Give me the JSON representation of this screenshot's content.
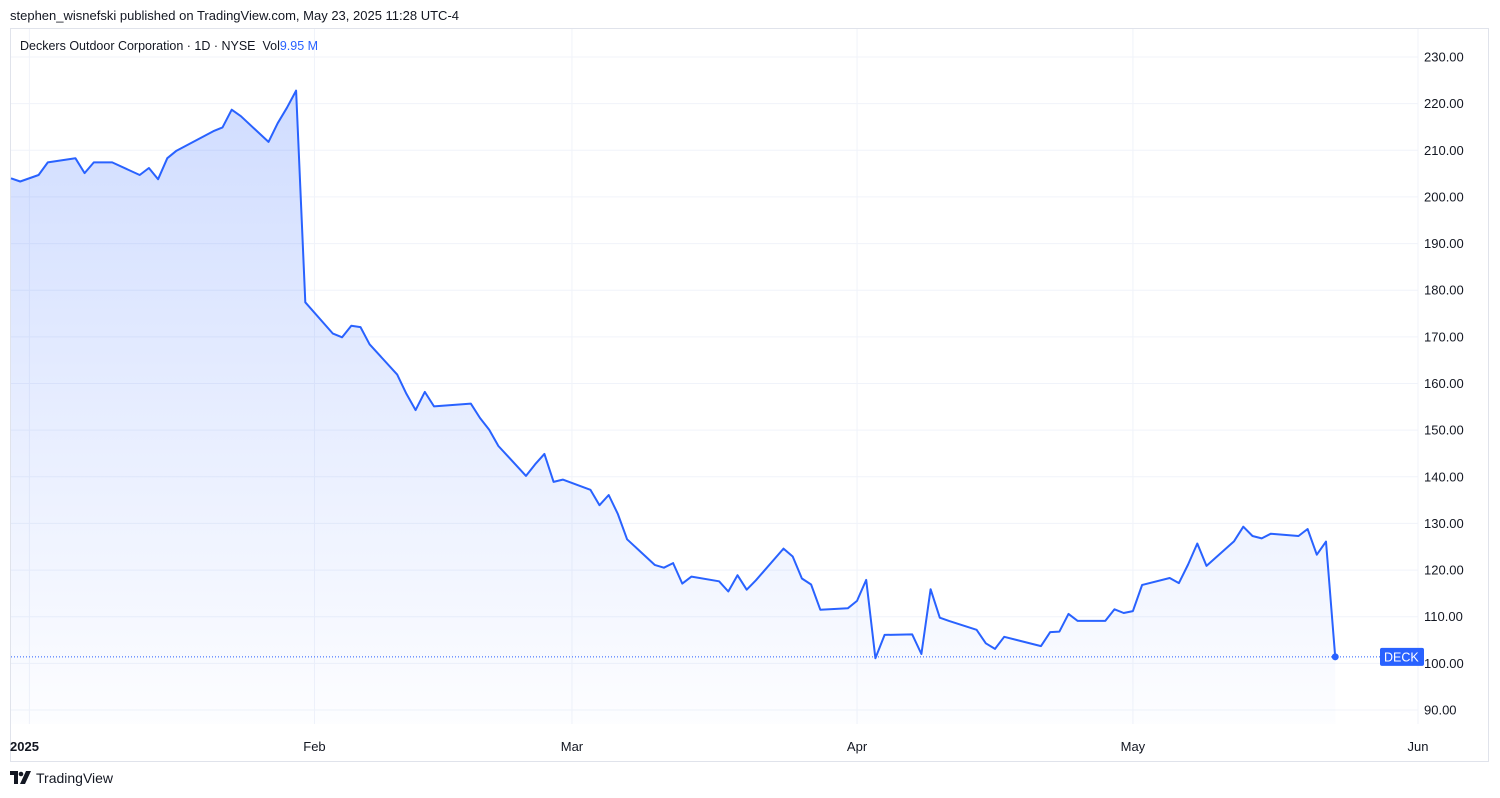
{
  "publisher_line": "stephen_wisnefski published on TradingView.com, May 23, 2025 11:28 UTC-4",
  "legend": {
    "symbol": "Deckers Outdoor Corporation · 1D · NYSE",
    "vol_label": "Vol",
    "vol_value": "9.95 M"
  },
  "footer": {
    "brand": "TradingView",
    "logo_icon": "tradingview-logo-icon"
  },
  "colors": {
    "line": "#2962ff",
    "grid": "#f0f3fa",
    "axis_text": "#131722"
  },
  "chart_data": {
    "type": "area",
    "title": "",
    "ylim": [
      87,
      236
    ],
    "y_ticks": [
      90,
      100,
      110,
      120,
      130,
      140,
      150,
      160,
      170,
      180,
      190,
      200,
      210,
      220,
      230
    ],
    "y_tick_labels": [
      "90.00",
      "100.00",
      "110.00",
      "120.00",
      "130.00",
      "140.00",
      "150.00",
      "160.00",
      "170.00",
      "180.00",
      "190.00",
      "200.00",
      "210.00",
      "220.00",
      "230.00"
    ],
    "x_ticks": [
      {
        "date": "2025-01-01",
        "label": "2025",
        "bold": true
      },
      {
        "date": "2025-02-01",
        "label": "Feb"
      },
      {
        "date": "2025-03-01",
        "label": "Mar"
      },
      {
        "date": "2025-04-01",
        "label": "Apr"
      },
      {
        "date": "2025-05-01",
        "label": "May"
      },
      {
        "date": "2025-06-01",
        "label": "Jun"
      }
    ],
    "xlim": [
      "2024-12-30",
      "2025-06-01"
    ],
    "last_value_label": "DECK",
    "last_value": 101.4,
    "grid": true,
    "series": [
      {
        "x": [
          "2024-12-30",
          "2024-12-31",
          "2025-01-02",
          "2025-01-03",
          "2025-01-06",
          "2025-01-07",
          "2025-01-08",
          "2025-01-10",
          "2025-01-13",
          "2025-01-14",
          "2025-01-15",
          "2025-01-16",
          "2025-01-17",
          "2025-01-21",
          "2025-01-22",
          "2025-01-23",
          "2025-01-24",
          "2025-01-27",
          "2025-01-28",
          "2025-01-29",
          "2025-01-30",
          "2025-01-31",
          "2025-02-03",
          "2025-02-04",
          "2025-02-05",
          "2025-02-06",
          "2025-02-07",
          "2025-02-10",
          "2025-02-11",
          "2025-02-12",
          "2025-02-13",
          "2025-02-14",
          "2025-02-18",
          "2025-02-19",
          "2025-02-20",
          "2025-02-21",
          "2025-02-24",
          "2025-02-25",
          "2025-02-26",
          "2025-02-27",
          "2025-02-28",
          "2025-03-03",
          "2025-03-04",
          "2025-03-05",
          "2025-03-06",
          "2025-03-07",
          "2025-03-10",
          "2025-03-11",
          "2025-03-12",
          "2025-03-13",
          "2025-03-14",
          "2025-03-17",
          "2025-03-18",
          "2025-03-19",
          "2025-03-20",
          "2025-03-21",
          "2025-03-24",
          "2025-03-25",
          "2025-03-26",
          "2025-03-27",
          "2025-03-28",
          "2025-03-31",
          "2025-04-01",
          "2025-04-02",
          "2025-04-03",
          "2025-04-04",
          "2025-04-07",
          "2025-04-08",
          "2025-04-09",
          "2025-04-10",
          "2025-04-11",
          "2025-04-14",
          "2025-04-15",
          "2025-04-16",
          "2025-04-17",
          "2025-04-21",
          "2025-04-22",
          "2025-04-23",
          "2025-04-24",
          "2025-04-25",
          "2025-04-28",
          "2025-04-29",
          "2025-04-30",
          "2025-05-01",
          "2025-05-02",
          "2025-05-05",
          "2025-05-06",
          "2025-05-07",
          "2025-05-08",
          "2025-05-09",
          "2025-05-12",
          "2025-05-13",
          "2025-05-14",
          "2025-05-15",
          "2025-05-16",
          "2025-05-19",
          "2025-05-20",
          "2025-05-21",
          "2025-05-22",
          "2025-05-23"
        ],
        "values": [
          204,
          203.3,
          204.7,
          207.4,
          208.3,
          205.1,
          207.4,
          207.4,
          204.7,
          206.2,
          203.8,
          208.3,
          209.9,
          214.1,
          214.9,
          218.7,
          217.3,
          211.8,
          215.8,
          219.1,
          222.8,
          177.4,
          170.7,
          169.9,
          172.4,
          172.1,
          168.4,
          161.9,
          157.8,
          154.3,
          158.2,
          155.1,
          155.7,
          152.6,
          150.1,
          146.6,
          140.2,
          142.7,
          144.9,
          138.9,
          139.4,
          137.2,
          133.9,
          136.1,
          132,
          126.6,
          121.1,
          120.5,
          121.5,
          117.1,
          118.6,
          117.6,
          115.4,
          118.9,
          115.8,
          117.8,
          124.6,
          122.9,
          118.2,
          116.9,
          111.5,
          111.8,
          113.4,
          117.9,
          101.1,
          106.1,
          106.2,
          102,
          115.9,
          109.8,
          109.1,
          107.2,
          104.3,
          103.1,
          105.7,
          103.7,
          106.7,
          106.8,
          110.6,
          109.1,
          109.1,
          111.6,
          110.8,
          111.2,
          116.8,
          118.3,
          117.2,
          121.2,
          125.7,
          120.9,
          126.2,
          129.3,
          127.3,
          126.8,
          127.8,
          127.3,
          128.8,
          123.3,
          126.1,
          101.4
        ]
      }
    ]
  }
}
